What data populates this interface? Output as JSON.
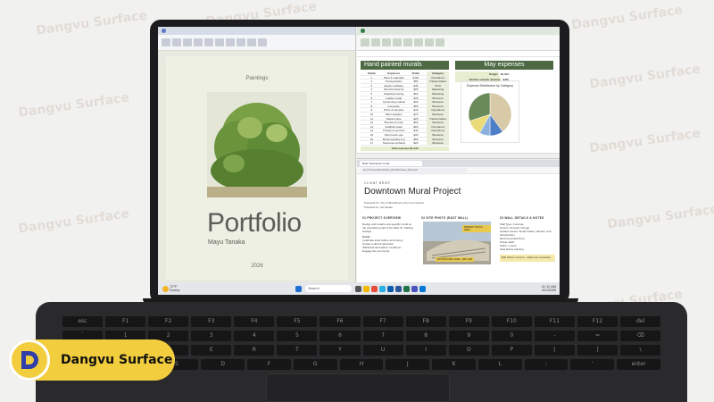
{
  "watermark": "Dangvu Surface",
  "logo": {
    "text": "Dangvu Surface",
    "accent": "#f2cd3d"
  },
  "word": {
    "category": "Paintings",
    "title": "Portfolio",
    "author": "Mayu Tanaka",
    "year": "2026"
  },
  "excel": {
    "table_title": "Hand painted murals",
    "summary_title": "May expenses",
    "columns": [
      "Detail",
      "Expenses",
      "Dollar",
      "Category"
    ],
    "rows": [
      [
        "1",
        "Paint & materials",
        "$120",
        "Operations"
      ],
      [
        "2",
        "Transportation",
        "$80",
        "Transportation"
      ],
      [
        "3",
        "Design software",
        "$45",
        "Tools"
      ],
      [
        "4",
        "Mural brushwork",
        "$95",
        "Marketing"
      ],
      [
        "5",
        "Weatherproofing",
        "$60",
        "Marketing"
      ],
      [
        "6",
        "Ladder rental",
        "$35",
        "Business"
      ],
      [
        "7",
        "Accounting software",
        "$30",
        "Business"
      ],
      [
        "8",
        "Insurance",
        "$55",
        "Business"
      ],
      [
        "9",
        "Prints & samples",
        "$40",
        "Operations"
      ],
      [
        "10",
        "Paint supplies",
        "$70",
        "Business"
      ],
      [
        "11",
        "Parking fees",
        "$25",
        "Transportation"
      ],
      [
        "12",
        "Brushes & tools",
        "$50",
        "Business"
      ],
      [
        "13",
        "Scaffold repair",
        "$65",
        "Operations"
      ],
      [
        "14",
        "Transport services",
        "$40",
        "Operations"
      ],
      [
        "15",
        "Paint touch-ups",
        "$30",
        "Business"
      ],
      [
        "16",
        "Mural supplies & support",
        "$55",
        "Business"
      ],
      [
        "17",
        "Tape/rope surfacing finish",
        "$20",
        "Business"
      ]
    ],
    "summary": [
      {
        "label": "Budget",
        "value": "$2,000"
      },
      {
        "label": "Website upgrade package",
        "value": "$450"
      }
    ],
    "chart_title": "Expense Distribution by Category",
    "footer": "Total expenses",
    "footer_value": "$1,440",
    "sheet_tab": "May expenses"
  },
  "chart_data": {
    "type": "pie",
    "title": "Expense Distribution by Category",
    "categories": [
      "Operations",
      "Transportation",
      "Tools",
      "Marketing",
      "Business"
    ],
    "values": [
      40,
      10,
      8,
      12,
      30
    ],
    "colors": [
      "#d8c9a7",
      "#4e7fc6",
      "#8bb0dd",
      "#eadb78",
      "#6b8a5a"
    ]
  },
  "browser": {
    "tab_label": "Brief: Downtown mural",
    "url": "file:///C:/Users/Mural/Client_Brief/Downtown_Mural.pdf",
    "label": "CLIENT BRIEF",
    "title": "Downtown Mural Project",
    "prepared_for": "Prepared for: City of Brookhaven Arts Commission",
    "prepared_by": "Prepared by: Set Studio",
    "col1_head": "01  PROJECT OVERVIEW",
    "col1_text": "Design and install a site-specific mural on the east-facing wall of the Main St. Parking Garage.",
    "col1_goals": "Goals:",
    "col1_items": [
      "Celebrate local culture and history",
      "Create a vibrant landmark",
      "Withstand all weather conditions",
      "Engage the community"
    ],
    "col2_head": "02  SITE PHOTO (EAST WALL)",
    "col2_badge1": "PRIMARY FOCUS AREA",
    "col2_badge2": "EXISTING WALL SIZE ~ 40ft x 22ft",
    "col3_head": "03  WALL DETAILS & NOTES",
    "col3_items": [
      "Wall Type: Concrete",
      "Texture: Smooth / Rough",
      "Surface Issues: Small cracks, patches, and discoloration",
      "Recommended Prep:",
      "Power wash",
      "Patch + prime",
      "Seal before painting"
    ],
    "col3_note": "Ball before concern - adjust as necessary"
  },
  "taskbar": {
    "weather_temp": "72°F",
    "weather_text": "Sunny",
    "search_placeholder": "Search",
    "time": "11:11 AM",
    "date": "6/1/2026"
  }
}
